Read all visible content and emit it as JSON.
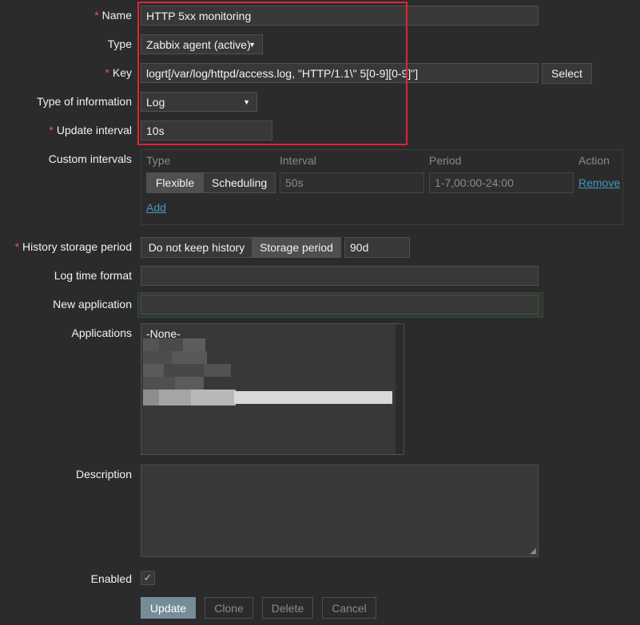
{
  "form": {
    "name": {
      "label": "Name",
      "value": "HTTP 5xx monitoring"
    },
    "type": {
      "label": "Type",
      "value": "Zabbix agent (active)"
    },
    "key": {
      "label": "Key",
      "value": "logrt[/var/log/httpd/access.log, \"HTTP/1.1\\\" 5[0-9][0-9]\"]",
      "select_label": "Select"
    },
    "type_of_information": {
      "label": "Type of information",
      "value": "Log"
    },
    "update_interval": {
      "label": "Update interval",
      "value": "10s"
    },
    "custom_intervals": {
      "label": "Custom intervals",
      "headers": {
        "type": "Type",
        "interval": "Interval",
        "period": "Period",
        "action": "Action"
      },
      "row": {
        "flexible": "Flexible",
        "scheduling": "Scheduling",
        "interval": "50s",
        "period": "1-7,00:00-24:00",
        "remove": "Remove"
      },
      "add": "Add"
    },
    "history": {
      "label": "History storage period",
      "option_no_keep": "Do not keep history",
      "option_storage": "Storage period",
      "value": "90d"
    },
    "log_time_format": {
      "label": "Log time format",
      "value": ""
    },
    "new_application": {
      "label": "New application",
      "value": ""
    },
    "applications": {
      "label": "Applications",
      "items": [
        "-None-"
      ]
    },
    "description": {
      "label": "Description",
      "value": ""
    },
    "enabled": {
      "label": "Enabled",
      "checked": true
    }
  },
  "actions": {
    "update": "Update",
    "clone": "Clone",
    "delete": "Delete",
    "cancel": "Cancel"
  },
  "colors": {
    "accent": "#4796c4",
    "required": "#e45959",
    "highlight": "#e0242f",
    "primary_button": "#768d99"
  }
}
